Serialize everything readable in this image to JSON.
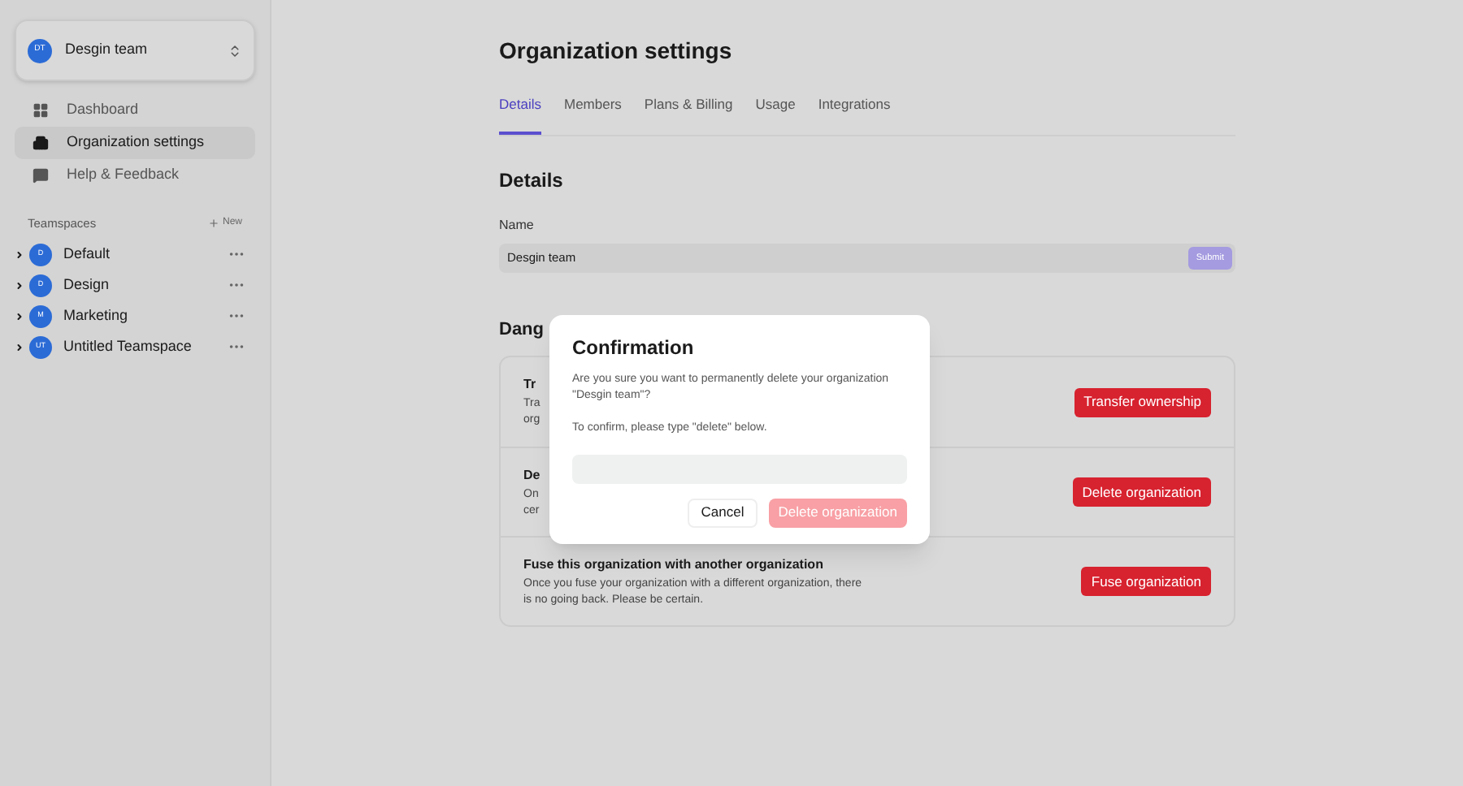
{
  "workspace_switcher": {
    "initials": "DT",
    "name": "Desgin team"
  },
  "sidebar": {
    "items": [
      {
        "label": "Dashboard",
        "kind": "grid",
        "selected": false
      },
      {
        "label": "Organization settings",
        "kind": "building",
        "selected": true
      },
      {
        "label": "Help & Feedback",
        "kind": "chat",
        "selected": false
      }
    ],
    "teamspaces": {
      "heading": "Teamspaces",
      "new_label": "New",
      "items": [
        {
          "initials": "D",
          "name": "Default",
          "expanded": false
        },
        {
          "initials": "D",
          "name": "Design",
          "expanded": false
        },
        {
          "initials": "M",
          "name": "Marketing",
          "expanded": false
        },
        {
          "initials": "UT",
          "name": "Untitled Teamspace",
          "expanded": false
        }
      ]
    }
  },
  "page": {
    "title": "Organization settings",
    "tabs": [
      {
        "label": "Details",
        "selected": true
      },
      {
        "label": "Members",
        "selected": false
      },
      {
        "label": "Plans & Billing",
        "selected": false
      },
      {
        "label": "Usage",
        "selected": false
      },
      {
        "label": "Integrations",
        "selected": false
      }
    ],
    "details": {
      "heading": "Details",
      "name_label": "Name",
      "name_value": "Desgin team",
      "submit": {
        "label": "Submit",
        "disabled": true
      }
    },
    "danger_zone": {
      "heading": "Dang",
      "rows": [
        {
          "title": "Tr",
          "description_lines": [
            "Tra",
            "org"
          ],
          "button": "Transfer ownership"
        },
        {
          "title": "De",
          "description_lines": [
            "On",
            "cer"
          ],
          "button": "Delete organization"
        },
        {
          "title": "Fuse this organization with another organization",
          "description_lines": [
            "Once you fuse your organization with a different organization, there",
            "is no going back. Please be certain."
          ],
          "button": "Fuse organization"
        }
      ]
    }
  },
  "dialog": {
    "title": "Confirmation",
    "message": "Are you sure you want to permanently delete your organization \"Desgin team\"?",
    "hint": "To confirm, please type \"delete\" below.",
    "cancel": "Cancel",
    "confirm": {
      "label": "Delete organization",
      "disabled": true
    }
  }
}
